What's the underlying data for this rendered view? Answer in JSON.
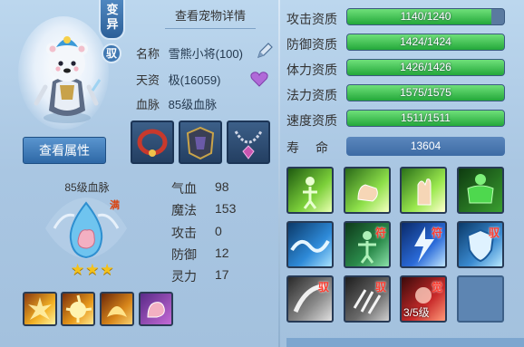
{
  "header": {
    "detail_link": "查看宠物详情",
    "mutant_badge": "变异",
    "circle_badge": "驭"
  },
  "pet_info": {
    "name_label": "名称",
    "name_value": "雪熊小将(100)",
    "talent_label": "天资",
    "talent_value": "极(16059)",
    "bloodline_label": "血脉",
    "bloodline_value": "85级血脉"
  },
  "buttons": {
    "view_attributes": "查看属性"
  },
  "bloodline_panel": {
    "title": "85级血脉",
    "full_tag": "满",
    "stars": "★★★",
    "star_count": 3
  },
  "stats": [
    {
      "label": "气血",
      "value": "98"
    },
    {
      "label": "魔法",
      "value": "153"
    },
    {
      "label": "攻击",
      "value": "0"
    },
    {
      "label": "防御",
      "value": "12"
    },
    {
      "label": "灵力",
      "value": "17"
    }
  ],
  "aptitudes": [
    {
      "label": "攻击资质",
      "text": "1140/1240",
      "fraction": 0.919
    },
    {
      "label": "防御资质",
      "text": "1424/1424",
      "fraction": 1.0
    },
    {
      "label": "体力资质",
      "text": "1426/1426",
      "fraction": 1.0
    },
    {
      "label": "法力资质",
      "text": "1575/1575",
      "fraction": 1.0
    },
    {
      "label": "速度资质",
      "text": "1511/1511",
      "fraction": 1.0
    }
  ],
  "life": {
    "label": "寿命",
    "value": "13604"
  },
  "skills": {
    "tags": {
      "fu": "符",
      "yu": "驭",
      "jue": "觉"
    },
    "awaken_level": "3/5级"
  },
  "colors": {
    "bar_fill": "#2fb044",
    "accent_blue": "#2e68a6",
    "tag_red": "#ff3b2e"
  }
}
